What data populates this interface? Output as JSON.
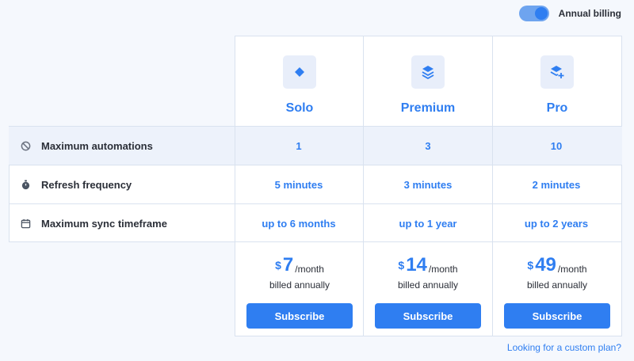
{
  "billing_toggle": {
    "label": "Annual billing",
    "on": true
  },
  "plans": [
    {
      "name": "Solo",
      "icon": "diamond-icon",
      "currency": "$",
      "price": "7",
      "period": "/month",
      "billed": "billed annually",
      "button": "Subscribe"
    },
    {
      "name": "Premium",
      "icon": "layers-icon",
      "currency": "$",
      "price": "14",
      "period": "/month",
      "billed": "billed annually",
      "button": "Subscribe"
    },
    {
      "name": "Pro",
      "icon": "layers-plus-icon",
      "currency": "$",
      "price": "49",
      "period": "/month",
      "billed": "billed annually",
      "button": "Subscribe"
    }
  ],
  "features": [
    {
      "label": "Maximum automations",
      "icon": "no-entry-icon",
      "values": [
        "1",
        "3",
        "10"
      ]
    },
    {
      "label": "Refresh frequency",
      "icon": "stopwatch-icon",
      "values": [
        "5 minutes",
        "3 minutes",
        "2 minutes"
      ]
    },
    {
      "label": "Maximum sync timeframe",
      "icon": "calendar-icon",
      "values": [
        "up to 6 months",
        "up to 1 year",
        "up to 2 years"
      ]
    }
  ],
  "custom_plan_link": "Looking for a custom plan?",
  "colors": {
    "accent": "#2f7ef1",
    "row_highlight": "#edf2fb",
    "border": "#d9e2ef",
    "background": "#f5f8fd"
  }
}
